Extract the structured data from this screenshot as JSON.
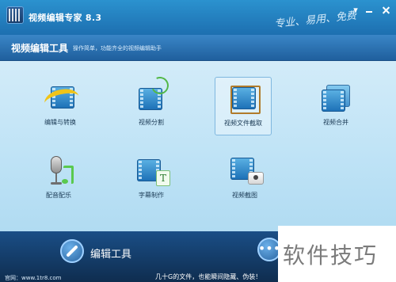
{
  "window": {
    "title": "视频编辑专家 8.3",
    "slogan": "专业、易用、免费"
  },
  "header": {
    "title": "视频编辑工具",
    "subtitle": "操作简单，功能齐全的视频编辑助手"
  },
  "tools": [
    {
      "label": "编辑与转换",
      "icon": "edit-convert-icon"
    },
    {
      "label": "视频分割",
      "icon": "video-split-icon"
    },
    {
      "label": "视频文件截取",
      "icon": "video-trim-icon",
      "selected": true
    },
    {
      "label": "视频合并",
      "icon": "video-merge-icon"
    },
    {
      "label": "配音配乐",
      "icon": "dubbing-music-icon"
    },
    {
      "label": "字幕制作",
      "icon": "subtitle-icon"
    },
    {
      "label": "视频截图",
      "icon": "screenshot-icon"
    }
  ],
  "footer": {
    "edit_label": "编辑工具",
    "more_label": "•••",
    "site": "官网：www.1tr8.com",
    "promo_link": "几十G的文件，也能瞬间隐藏、伪装！"
  },
  "watermark": {
    "text": "软件技巧"
  },
  "colors": {
    "title_bar": "#1d6fb0",
    "accent": "#2b92cf",
    "footer": "#0f2d4f"
  }
}
